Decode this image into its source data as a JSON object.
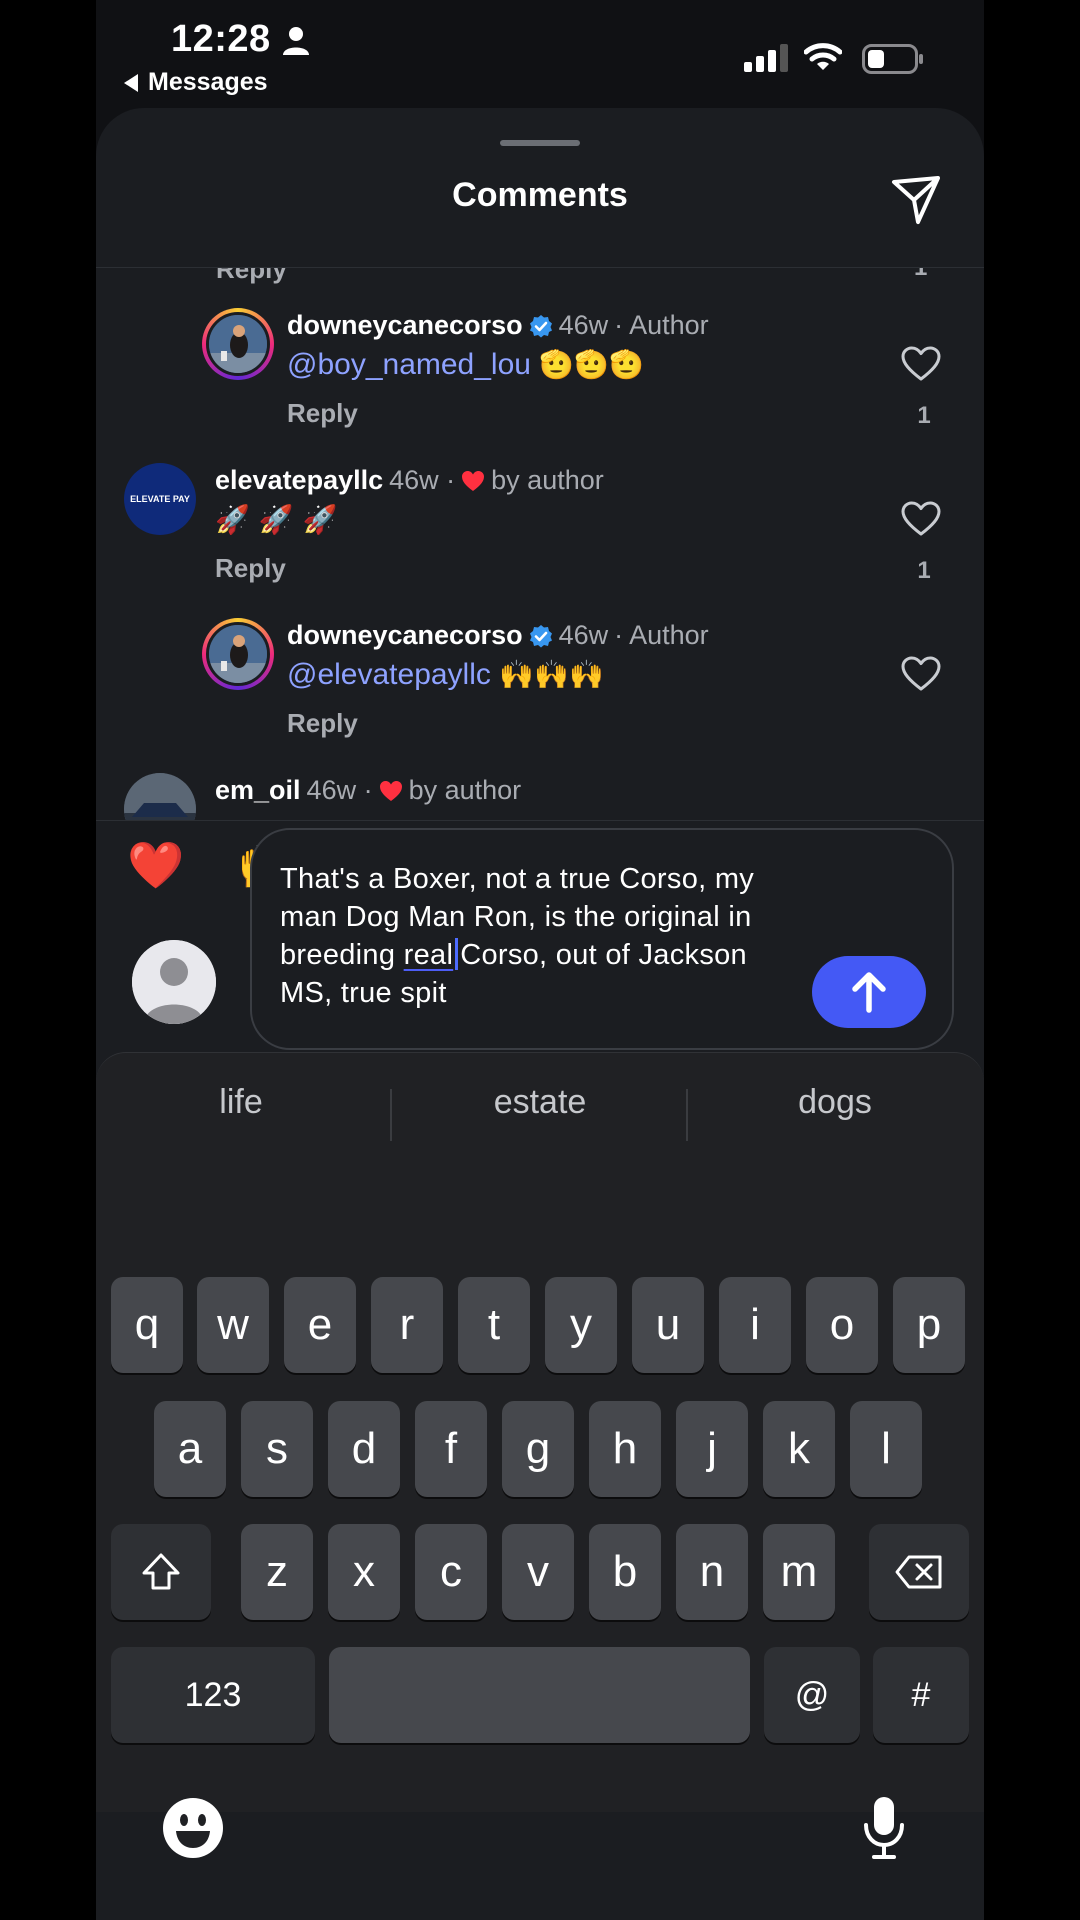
{
  "status_bar": {
    "time": "12:28",
    "back_label": "Messages"
  },
  "sheet": {
    "title": "Comments"
  },
  "clipped_previous": {
    "reply_label": "Reply",
    "like_count": "1"
  },
  "comments": [
    {
      "username": "downeycanecorso",
      "time": "46w",
      "tag": "· Author",
      "verified": true,
      "mention": "@boy_named_lou",
      "emojis": "🫡🫡🫡",
      "reply_label": "Reply",
      "like_count": "1"
    },
    {
      "username": "elevatepayllc",
      "time": "46w ·",
      "liked_by": "by author",
      "avatar_text": "ELEVATE PAY",
      "emojis": "🚀 🚀 🚀",
      "reply_label": "Reply",
      "like_count": "1"
    },
    {
      "username": "downeycanecorso",
      "time": "46w",
      "tag": "· Author",
      "verified": true,
      "mention": "@elevatepayllc",
      "emojis": "🙌🙌🙌",
      "reply_label": "Reply",
      "like_count": ""
    },
    {
      "username": "em_oil",
      "time": "46w ·",
      "liked_by": "by author"
    }
  ],
  "reactions": [
    "❤️",
    "🙌",
    "🔥",
    "👏",
    "😢",
    "😍",
    "😮",
    "😂"
  ],
  "composer": {
    "text_before": "That's a Boxer, not a true Corso, my man Dog Man Ron, is the original in breeding ",
    "underlined": "real",
    "text_after": "Corso, out of Jackson MS, true spit"
  },
  "keyboard": {
    "suggestions": [
      "life",
      "estate",
      "dogs"
    ],
    "row1": [
      "q",
      "w",
      "e",
      "r",
      "t",
      "y",
      "u",
      "i",
      "o",
      "p"
    ],
    "row2": [
      "a",
      "s",
      "d",
      "f",
      "g",
      "h",
      "j",
      "k",
      "l"
    ],
    "row3": [
      "z",
      "x",
      "c",
      "v",
      "b",
      "n",
      "m"
    ],
    "numbers_label": "123",
    "at_label": "@",
    "hash_label": "#"
  },
  "colors": {
    "accent": "#4459f5",
    "mention": "#8ea2ff",
    "verified": "#3897f0",
    "heart": "#ff3040"
  },
  "icons": [
    "person-icon",
    "signal-icon",
    "wifi-icon",
    "battery-icon",
    "share-icon",
    "heart-icon",
    "verified-icon",
    "send-arrow-icon",
    "shift-icon",
    "delete-icon",
    "emoji-icon",
    "mic-icon"
  ]
}
